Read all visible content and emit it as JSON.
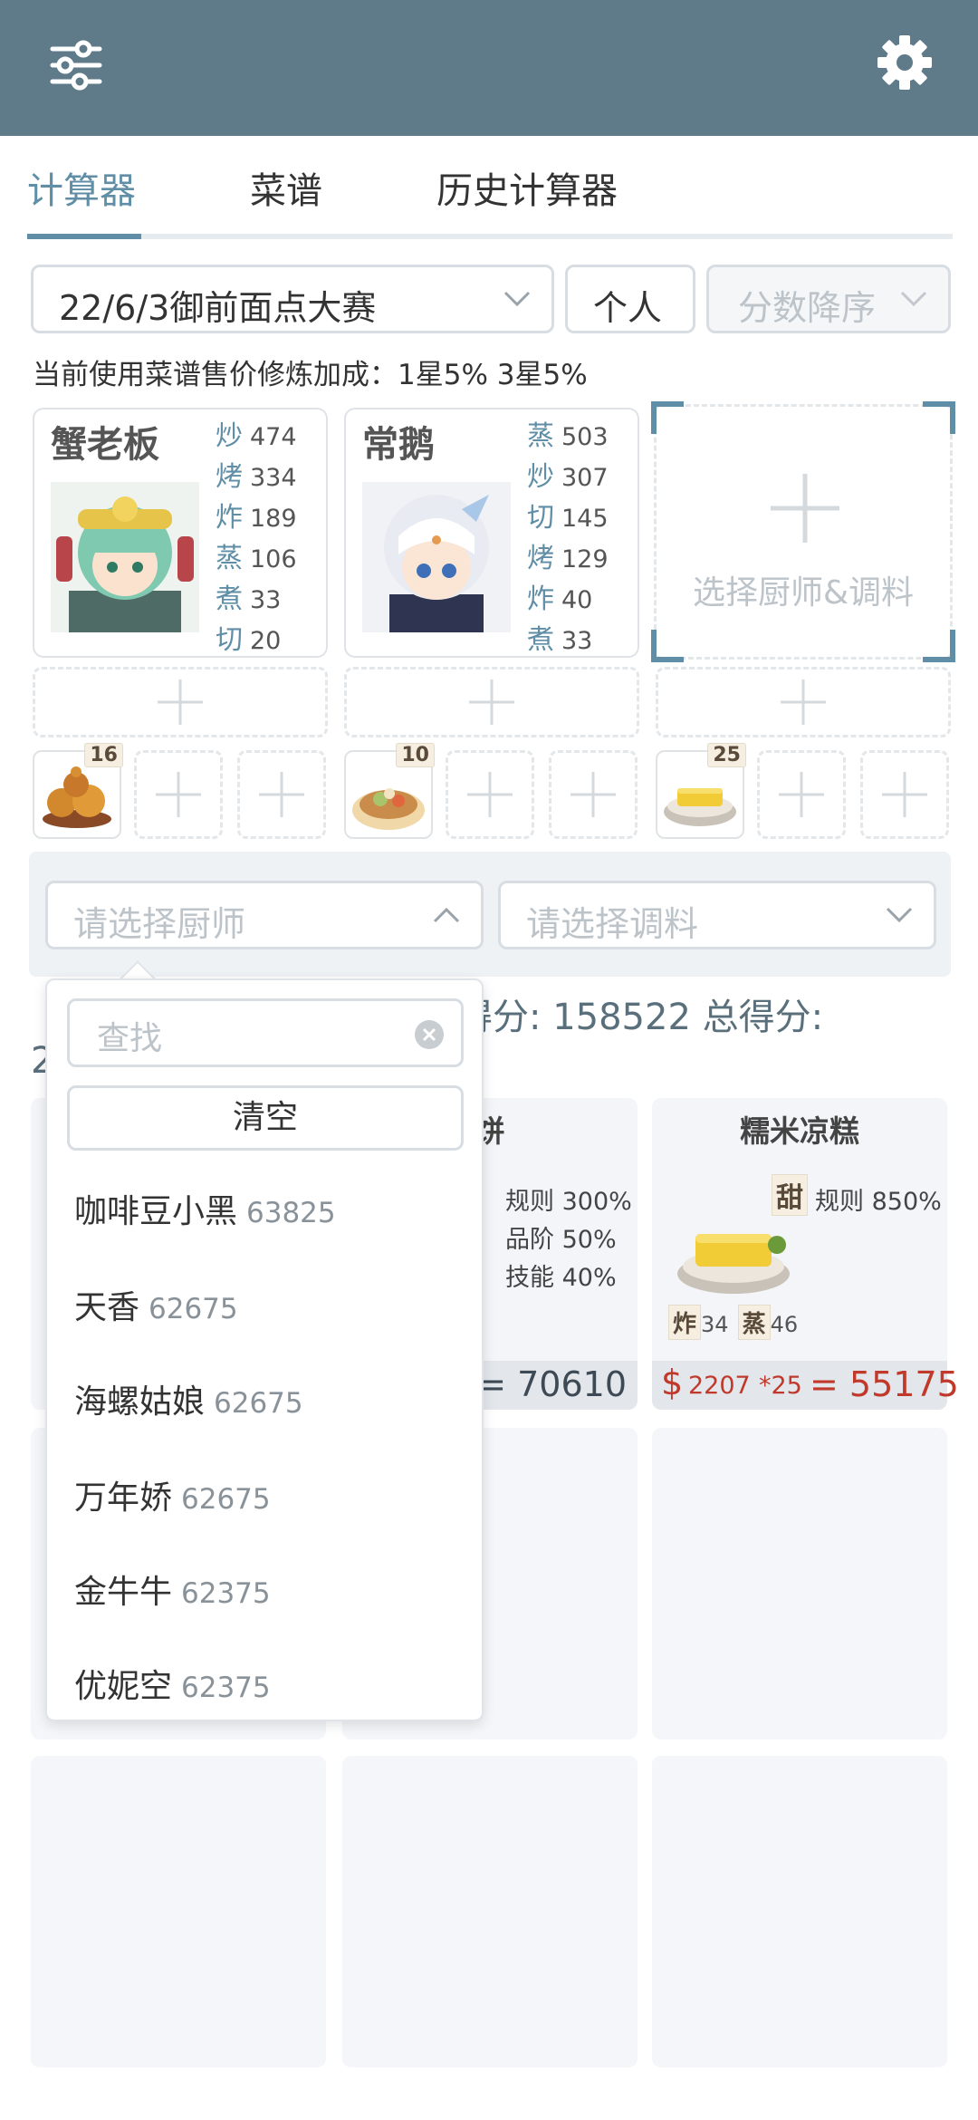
{
  "tabs": [
    "计算器",
    "菜谱",
    "历史计算器"
  ],
  "selectors": {
    "contest": "22/6/3御前面点大赛",
    "mode": "个人",
    "sort": "分数降序"
  },
  "notice": "当前使用菜谱售价修炼加成：1星5% 3星5%",
  "chefs": [
    {
      "name": "蟹老板",
      "skills": [
        {
          "k": "炒",
          "v": "474"
        },
        {
          "k": "烤",
          "v": "334"
        },
        {
          "k": "炸",
          "v": "189"
        },
        {
          "k": "蒸",
          "v": "106"
        },
        {
          "k": "煮",
          "v": "33"
        },
        {
          "k": "切",
          "v": "20"
        }
      ]
    },
    {
      "name": "常鹅",
      "skills": [
        {
          "k": "蒸",
          "v": "503"
        },
        {
          "k": "炒",
          "v": "307"
        },
        {
          "k": "切",
          "v": "145"
        },
        {
          "k": "烤",
          "v": "129"
        },
        {
          "k": "炸",
          "v": "40"
        },
        {
          "k": "煮",
          "v": "33"
        }
      ]
    }
  ],
  "add_chef_label": "选择厨师&调料",
  "dish_counts": [
    "16",
    "10",
    "25"
  ],
  "filters": {
    "chef_placeholder": "请选择厨师",
    "seasoning_placeholder": "请选择调料"
  },
  "score": {
    "line1_prefix": "得分: ",
    "line1_value": "158522",
    "line1_mid": " 总得分: ",
    "line2": "2"
  },
  "dish_cards": [
    {
      "title": "饼",
      "conds": [
        "规则 300%",
        "品阶 50%",
        "技能 40%"
      ],
      "price_total": "= 70610"
    },
    {
      "title": "糯米凉糕",
      "flavor": "甜",
      "conds": [
        "规则 850%"
      ],
      "tags": [
        {
          "k": "炸",
          "v": "34"
        },
        {
          "k": "蒸",
          "v": "46"
        }
      ],
      "price_symbol": "$",
      "price": "2207",
      "mult": "*25",
      "price_total": "= 55175"
    }
  ],
  "dropdown": {
    "search_placeholder": "查找",
    "clear_label": "清空",
    "items": [
      {
        "name": "咖啡豆小黑",
        "score": "63825"
      },
      {
        "name": "天香",
        "score": "62675"
      },
      {
        "name": "海螺姑娘",
        "score": "62675"
      },
      {
        "name": "万年娇",
        "score": "62675"
      },
      {
        "name": "金牛牛",
        "score": "62375"
      },
      {
        "name": "优妮空",
        "score": "62375"
      }
    ]
  },
  "colors": {
    "header": "#5f7a89",
    "accent": "#5f8ea6",
    "price_red": "#c0392b"
  },
  "icons": [
    "sliders-icon",
    "gear-icon",
    "chevron-down-icon",
    "chevron-up-icon",
    "plus-icon",
    "clear-circle-icon"
  ]
}
